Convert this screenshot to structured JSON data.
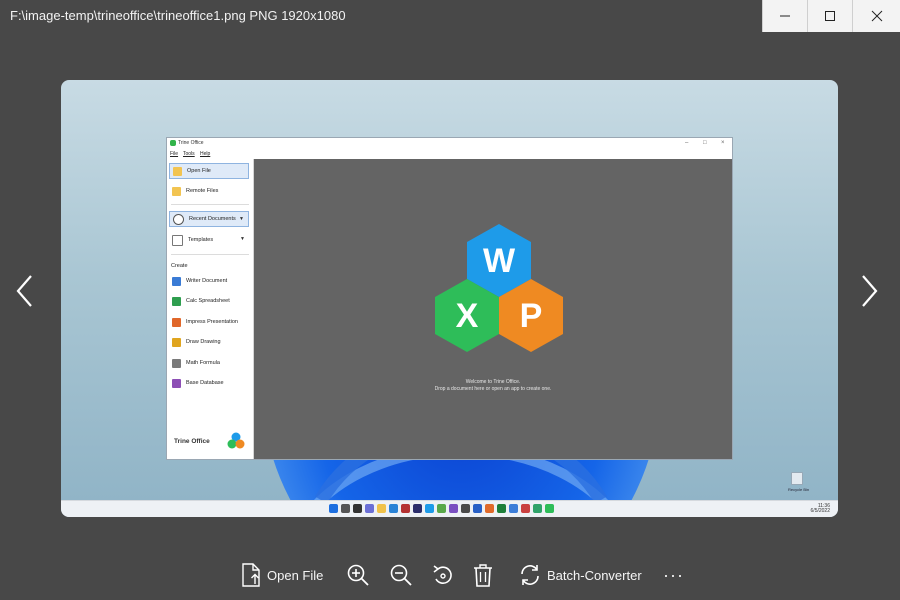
{
  "window": {
    "title": "F:\\image-temp\\trineoffice\\trineoffice1.png PNG 1920x1080",
    "controls": [
      "minimize-icon",
      "maximize-icon",
      "close-icon"
    ]
  },
  "screenshot": {
    "app": {
      "title": "Trine Office",
      "menu": [
        "File",
        "Tools",
        "Help"
      ],
      "sidebar": {
        "open_file": "Open File",
        "remote_files": "Remote Files",
        "recent_documents": "Recent Documents",
        "templates": "Templates",
        "create_label": "Create",
        "create_items": [
          {
            "label": "Writer Document",
            "color": "#3a7bd5"
          },
          {
            "label": "Calc Spreadsheet",
            "color": "#2e9e4f"
          },
          {
            "label": "Impress Presentation",
            "color": "#e0672a"
          },
          {
            "label": "Draw Drawing",
            "color": "#e0a51f"
          },
          {
            "label": "Math Formula",
            "color": "#7a7a7a"
          },
          {
            "label": "Base Database",
            "color": "#8d4fb5"
          }
        ],
        "brand": "Trine Office"
      },
      "logo_letters": {
        "w": "W",
        "x": "X",
        "p": "P"
      },
      "logo_colors": {
        "w": "#1e9be9",
        "x": "#2ebd59",
        "p": "#ef8a22"
      },
      "welcome_line1": "Welcome to Trine Office.",
      "welcome_line2": "Drop a document here or open an app to create one."
    },
    "recycle_bin": "Recycle Bin",
    "taskbar_time": "11:36",
    "taskbar_date": "6/5/2022"
  },
  "toolbar": {
    "open_file": "Open File",
    "batch_converter": "Batch-Converter",
    "more": "···"
  },
  "colors": {
    "background": "#484848",
    "accent_blue": "#1e9be9",
    "accent_green": "#2ebd59",
    "accent_orange": "#ef8a22"
  }
}
